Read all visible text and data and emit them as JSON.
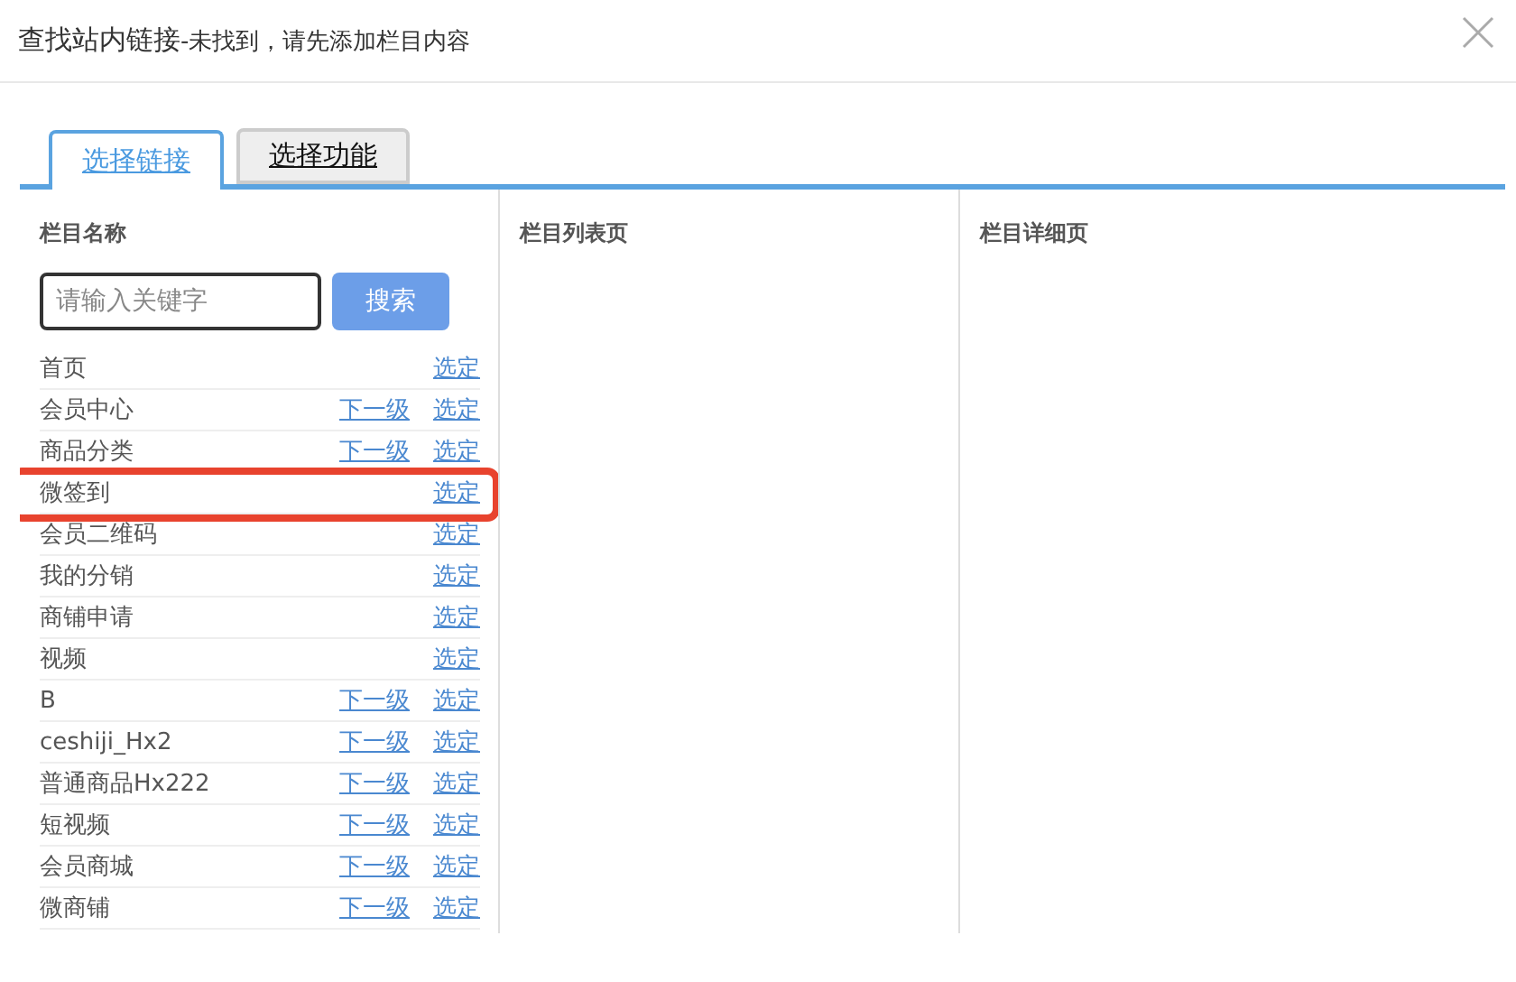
{
  "window": {
    "title": "查找站内链接",
    "subtitle": "-未找到，请先添加栏目内容"
  },
  "tabs": [
    {
      "label": "选择链接",
      "selected": true
    },
    {
      "label": "选择功能",
      "selected": false
    }
  ],
  "columns": [
    {
      "heading": "栏目名称"
    },
    {
      "heading": "栏目列表页"
    },
    {
      "heading": "栏目详细页"
    }
  ],
  "search": {
    "placeholder": "请输入关键字",
    "button": "搜索"
  },
  "rows": [
    {
      "name": "首页",
      "select": "选定",
      "highlighted": false
    },
    {
      "name": "会员中心",
      "next": "下一级",
      "select": "选定",
      "highlighted": false
    },
    {
      "name": "商品分类",
      "next": "下一级",
      "select": "选定",
      "highlighted": false
    },
    {
      "name": "微签到",
      "select": "选定",
      "highlighted": true
    },
    {
      "name": "会员二维码",
      "select": "选定",
      "highlighted": false
    },
    {
      "name": "我的分销",
      "select": "选定",
      "highlighted": false
    },
    {
      "name": "商铺申请",
      "select": "选定",
      "highlighted": false
    },
    {
      "name": "视频",
      "select": "选定",
      "highlighted": false
    },
    {
      "name": "B",
      "next": "下一级",
      "select": "选定",
      "highlighted": false
    },
    {
      "name": "ceshiji_Hx2",
      "next": "下一级",
      "select": "选定",
      "highlighted": false
    },
    {
      "name": "普通商品Hx222",
      "next": "下一级",
      "select": "选定",
      "highlighted": false
    },
    {
      "name": "短视频",
      "next": "下一级",
      "select": "选定",
      "highlighted": false
    },
    {
      "name": "会员商城",
      "next": "下一级",
      "select": "选定",
      "highlighted": false
    },
    {
      "name": "微商铺",
      "next": "下一级",
      "select": "选定",
      "highlighted": false
    }
  ]
}
